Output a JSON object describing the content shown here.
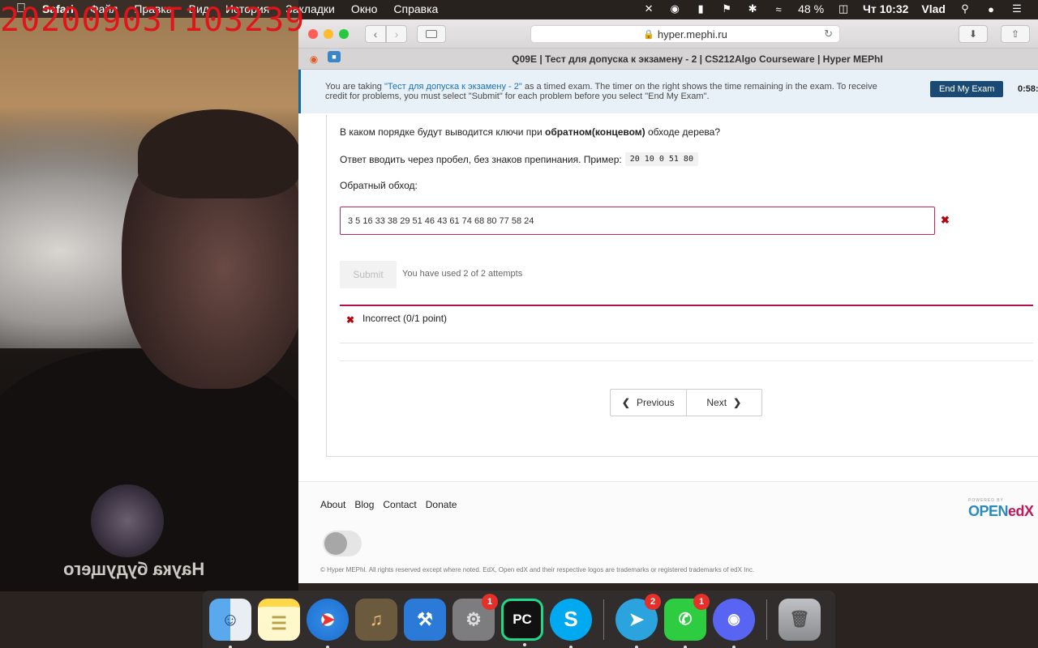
{
  "overlay": {
    "timestamp": "20200903T103239"
  },
  "webcam": {
    "shirt_text": "Наука будущего"
  },
  "menubar": {
    "app_name": "Safari",
    "menus": [
      "Файл",
      "Правка",
      "Вид",
      "История",
      "Закладки",
      "Окно",
      "Справка"
    ],
    "battery": "48 %",
    "clock": "Чт 10:32",
    "user": "Vlad"
  },
  "browser": {
    "url": "hyper.mephi.ru",
    "tab_title": "Q09E | Тест для допуска к экзамену - 2 | CS212Algo Courseware | Hyper MEPhI"
  },
  "exam_banner": {
    "text_before": "You are taking ",
    "exam_link": "\"Тест для допуска к экзамену - 2\"",
    "text_after": " as a timed exam. The timer on the right shows the time remaining in the exam. To receive credit for problems, you must select \"Submit\" for each problem before you select \"End My Exam\".",
    "end_button": "End My Exam",
    "timer": "0:58:"
  },
  "problem": {
    "question_prefix": "В каком порядке будут выводится ключи при ",
    "question_bold": "обратном(концевом)",
    "question_suffix": " обходе дерева?",
    "instruction": "Ответ вводить через пробел, без знаков препинания. Пример:",
    "example": "20 10 0 51 80",
    "input_label": "Обратный обход:",
    "answer_value": "3 5 16 33 38 29 51 46 43 61 74 68 80 77 58 24",
    "submit_label": "Submit",
    "attempts": "You have used 2 of 2 attempts",
    "result": "Incorrect (0/1 point)"
  },
  "sequence_nav": {
    "previous": "Previous",
    "next": "Next"
  },
  "footer": {
    "links": [
      "About",
      "Blog",
      "Contact",
      "Donate"
    ],
    "copyright": "© Hyper MEPhI. All rights reserved except where noted. EdX, Open edX and their respective logos are trademarks or registered trademarks of edX Inc.",
    "powered_by": "POWERED BY",
    "brand_open": "OPEN",
    "brand_edx": "edX"
  },
  "dock": {
    "badges": {
      "system_prefs": "1",
      "telegram": "2",
      "facetime": "1"
    }
  },
  "colors": {
    "accent": "#126aa3",
    "error": "#b20610",
    "end_exam": "#1a4a73"
  }
}
